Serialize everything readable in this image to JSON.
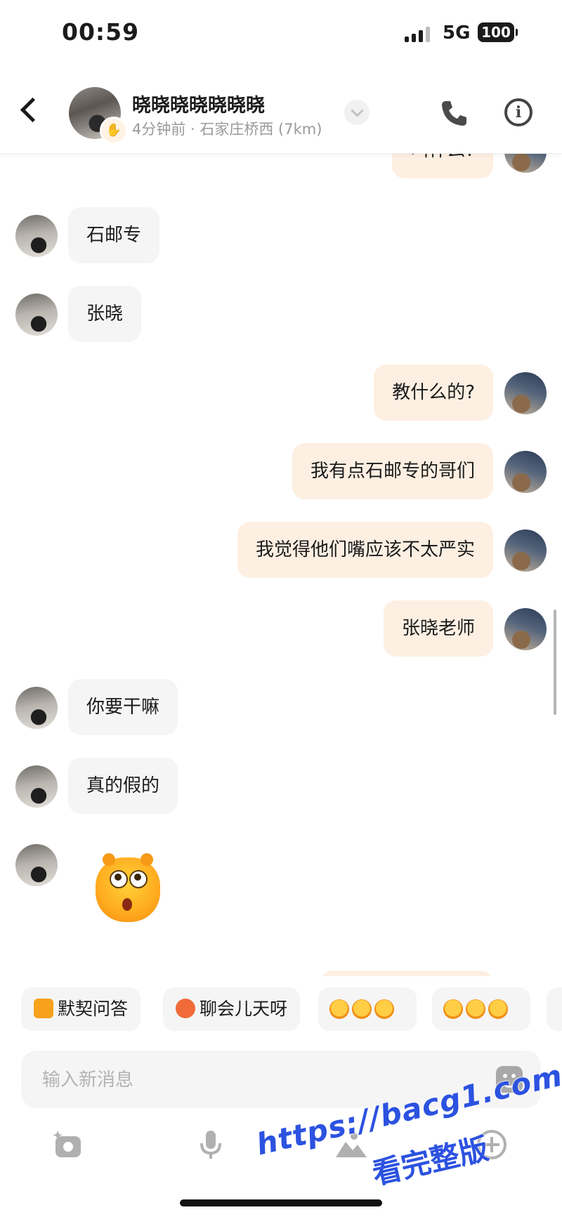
{
  "status_bar": {
    "time": "00:59",
    "network": "5G",
    "battery": "100"
  },
  "header": {
    "contact_name": "晓晓晓晓晓晓晓",
    "contact_meta": "4分钟前 · 石家庄桥西 (7km)"
  },
  "messages": [
    {
      "from": "me",
      "text": "叫什么?"
    },
    {
      "from": "them",
      "text": "石邮专"
    },
    {
      "from": "them",
      "text": "张晓"
    },
    {
      "from": "me",
      "text": "教什么的?"
    },
    {
      "from": "me",
      "text": "我有点石邮专的哥们"
    },
    {
      "from": "me",
      "text": "我觉得他们嘴应该不太严实"
    },
    {
      "from": "me",
      "text": "张晓老师"
    },
    {
      "from": "them",
      "text": "你要干嘛"
    },
    {
      "from": "them",
      "text": "真的假的"
    },
    {
      "from": "them",
      "sticker": "surprised-face-sticker"
    }
  ],
  "quick_replies": [
    {
      "label": "默契问答",
      "icon": "pencil-quiz-icon",
      "color": "#f7a21b"
    },
    {
      "label": "聊会儿天呀",
      "icon": "chat-mascot-icon",
      "color": "#f06a3a"
    },
    {
      "label": "",
      "icon": "emoji-set-1"
    },
    {
      "label": "",
      "icon": "emoji-set-2"
    }
  ],
  "input": {
    "placeholder": "输入新消息"
  },
  "watermark": {
    "line1": "https://bacg1.com",
    "line2": "看完整版"
  },
  "colors": {
    "my_bubble": "#fdefe2",
    "their_bubble": "#f5f5f5",
    "watermark": "#2c52e0"
  }
}
